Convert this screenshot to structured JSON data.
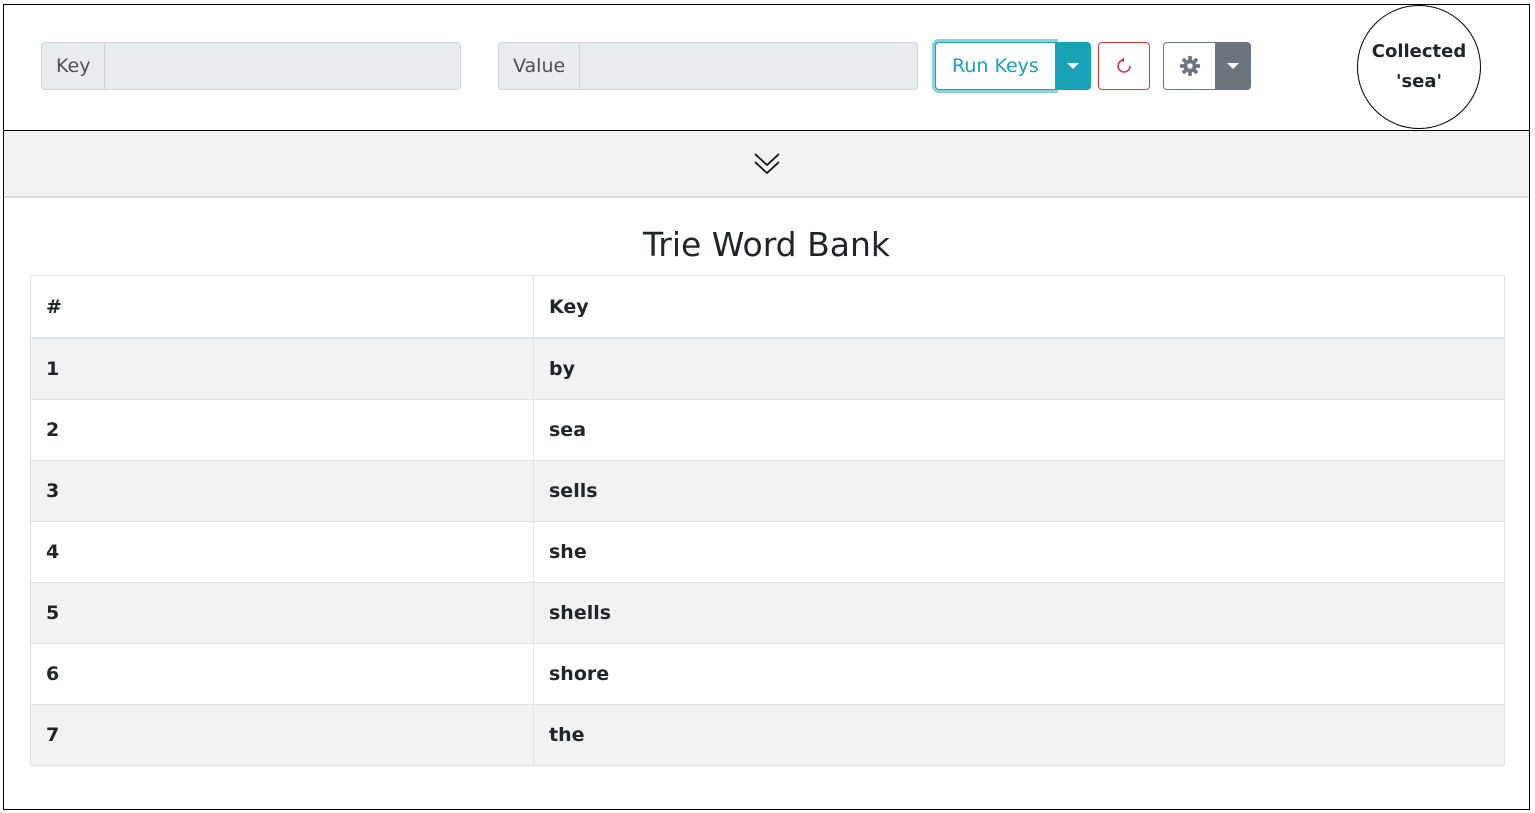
{
  "toolbar": {
    "key_label": "Key",
    "key_value": "",
    "value_label": "Value",
    "value_value": "",
    "run_label": "Run Keys",
    "reset_icon": "reset-icon",
    "settings_icon": "gear-icon",
    "accent_color": "#17a2b8",
    "danger_color": "#dc3545",
    "secondary_color": "#6c757d"
  },
  "status": {
    "line1": "Collected",
    "line2": "'sea'"
  },
  "collapse": {
    "icon": "double-chevron-down-icon"
  },
  "main": {
    "title": "Trie Word Bank",
    "table": {
      "headers": [
        "#",
        "Key"
      ],
      "rows": [
        {
          "num": "1",
          "key": "by"
        },
        {
          "num": "2",
          "key": "sea"
        },
        {
          "num": "3",
          "key": "sells"
        },
        {
          "num": "4",
          "key": "she"
        },
        {
          "num": "5",
          "key": "shells"
        },
        {
          "num": "6",
          "key": "shore"
        },
        {
          "num": "7",
          "key": "the"
        }
      ]
    }
  }
}
